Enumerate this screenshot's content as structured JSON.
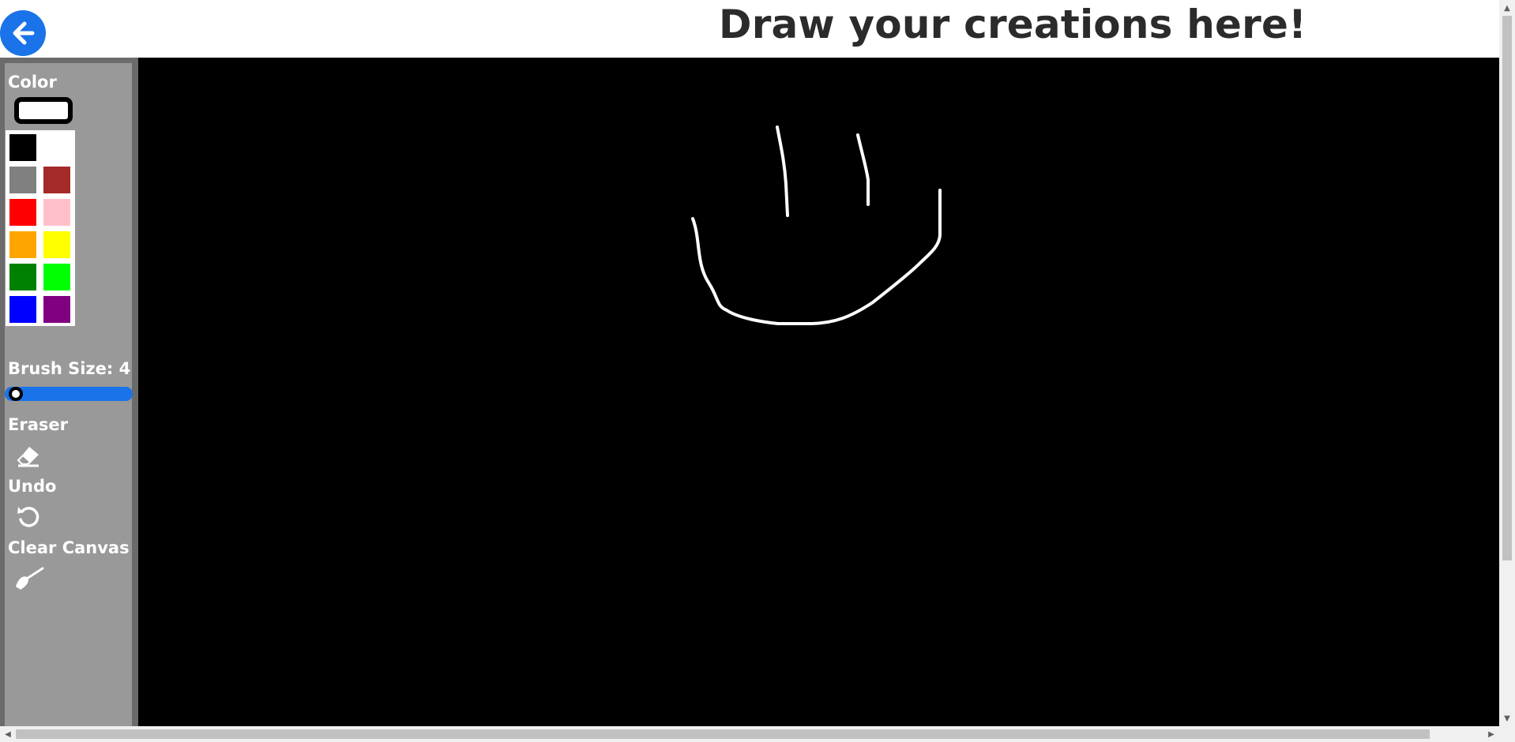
{
  "header": {
    "title": "Draw your creations here!",
    "back_icon": "arrow-left-icon"
  },
  "sidebar": {
    "color_label": "Color",
    "selected_color": "#ffffff",
    "palette": [
      {
        "name": "black",
        "hex": "#000000"
      },
      {
        "name": "white",
        "hex": "#ffffff"
      },
      {
        "name": "gray",
        "hex": "#808080"
      },
      {
        "name": "brown",
        "hex": "#a52a2a"
      },
      {
        "name": "red",
        "hex": "#ff0000"
      },
      {
        "name": "pink",
        "hex": "#ffc0cb"
      },
      {
        "name": "orange",
        "hex": "#ffa500"
      },
      {
        "name": "yellow",
        "hex": "#ffff00"
      },
      {
        "name": "green",
        "hex": "#008000"
      },
      {
        "name": "lime",
        "hex": "#00ff00"
      },
      {
        "name": "blue",
        "hex": "#0000ff"
      },
      {
        "name": "purple",
        "hex": "#800080"
      }
    ],
    "brush_size_label": "Brush Size: 4",
    "brush_size": 4,
    "eraser_label": "Eraser",
    "eraser_icon": "eraser-icon",
    "undo_label": "Undo",
    "undo_icon": "undo-icon",
    "clear_label": "Clear Canvas",
    "clear_icon": "broom-icon"
  },
  "canvas": {
    "background": "#000000",
    "stroke_color": "#ffffff",
    "drawing": "smiley face"
  }
}
